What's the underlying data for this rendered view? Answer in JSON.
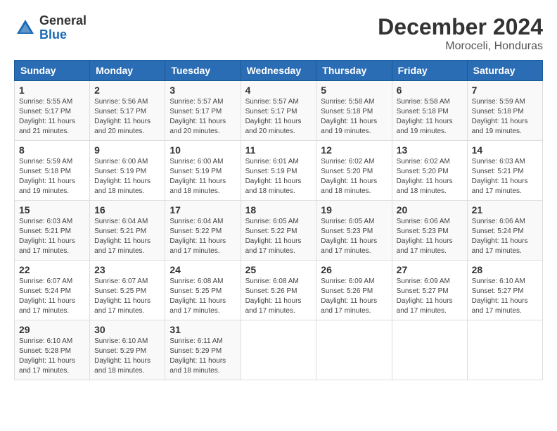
{
  "header": {
    "logo": {
      "line1": "General",
      "line2": "Blue"
    },
    "title": "December 2024",
    "subtitle": "Moroceli, Honduras"
  },
  "weekdays": [
    "Sunday",
    "Monday",
    "Tuesday",
    "Wednesday",
    "Thursday",
    "Friday",
    "Saturday"
  ],
  "weeks": [
    [
      {
        "day": 1,
        "sunrise": "5:55 AM",
        "sunset": "5:17 PM",
        "daylight": "11 hours and 21 minutes."
      },
      {
        "day": 2,
        "sunrise": "5:56 AM",
        "sunset": "5:17 PM",
        "daylight": "11 hours and 20 minutes."
      },
      {
        "day": 3,
        "sunrise": "5:57 AM",
        "sunset": "5:17 PM",
        "daylight": "11 hours and 20 minutes."
      },
      {
        "day": 4,
        "sunrise": "5:57 AM",
        "sunset": "5:17 PM",
        "daylight": "11 hours and 20 minutes."
      },
      {
        "day": 5,
        "sunrise": "5:58 AM",
        "sunset": "5:18 PM",
        "daylight": "11 hours and 19 minutes."
      },
      {
        "day": 6,
        "sunrise": "5:58 AM",
        "sunset": "5:18 PM",
        "daylight": "11 hours and 19 minutes."
      },
      {
        "day": 7,
        "sunrise": "5:59 AM",
        "sunset": "5:18 PM",
        "daylight": "11 hours and 19 minutes."
      }
    ],
    [
      {
        "day": 8,
        "sunrise": "5:59 AM",
        "sunset": "5:18 PM",
        "daylight": "11 hours and 19 minutes."
      },
      {
        "day": 9,
        "sunrise": "6:00 AM",
        "sunset": "5:19 PM",
        "daylight": "11 hours and 18 minutes."
      },
      {
        "day": 10,
        "sunrise": "6:00 AM",
        "sunset": "5:19 PM",
        "daylight": "11 hours and 18 minutes."
      },
      {
        "day": 11,
        "sunrise": "6:01 AM",
        "sunset": "5:19 PM",
        "daylight": "11 hours and 18 minutes."
      },
      {
        "day": 12,
        "sunrise": "6:02 AM",
        "sunset": "5:20 PM",
        "daylight": "11 hours and 18 minutes."
      },
      {
        "day": 13,
        "sunrise": "6:02 AM",
        "sunset": "5:20 PM",
        "daylight": "11 hours and 18 minutes."
      },
      {
        "day": 14,
        "sunrise": "6:03 AM",
        "sunset": "5:21 PM",
        "daylight": "11 hours and 17 minutes."
      }
    ],
    [
      {
        "day": 15,
        "sunrise": "6:03 AM",
        "sunset": "5:21 PM",
        "daylight": "11 hours and 17 minutes."
      },
      {
        "day": 16,
        "sunrise": "6:04 AM",
        "sunset": "5:21 PM",
        "daylight": "11 hours and 17 minutes."
      },
      {
        "day": 17,
        "sunrise": "6:04 AM",
        "sunset": "5:22 PM",
        "daylight": "11 hours and 17 minutes."
      },
      {
        "day": 18,
        "sunrise": "6:05 AM",
        "sunset": "5:22 PM",
        "daylight": "11 hours and 17 minutes."
      },
      {
        "day": 19,
        "sunrise": "6:05 AM",
        "sunset": "5:23 PM",
        "daylight": "11 hours and 17 minutes."
      },
      {
        "day": 20,
        "sunrise": "6:06 AM",
        "sunset": "5:23 PM",
        "daylight": "11 hours and 17 minutes."
      },
      {
        "day": 21,
        "sunrise": "6:06 AM",
        "sunset": "5:24 PM",
        "daylight": "11 hours and 17 minutes."
      }
    ],
    [
      {
        "day": 22,
        "sunrise": "6:07 AM",
        "sunset": "5:24 PM",
        "daylight": "11 hours and 17 minutes."
      },
      {
        "day": 23,
        "sunrise": "6:07 AM",
        "sunset": "5:25 PM",
        "daylight": "11 hours and 17 minutes."
      },
      {
        "day": 24,
        "sunrise": "6:08 AM",
        "sunset": "5:25 PM",
        "daylight": "11 hours and 17 minutes."
      },
      {
        "day": 25,
        "sunrise": "6:08 AM",
        "sunset": "5:26 PM",
        "daylight": "11 hours and 17 minutes."
      },
      {
        "day": 26,
        "sunrise": "6:09 AM",
        "sunset": "5:26 PM",
        "daylight": "11 hours and 17 minutes."
      },
      {
        "day": 27,
        "sunrise": "6:09 AM",
        "sunset": "5:27 PM",
        "daylight": "11 hours and 17 minutes."
      },
      {
        "day": 28,
        "sunrise": "6:10 AM",
        "sunset": "5:27 PM",
        "daylight": "11 hours and 17 minutes."
      }
    ],
    [
      {
        "day": 29,
        "sunrise": "6:10 AM",
        "sunset": "5:28 PM",
        "daylight": "11 hours and 17 minutes."
      },
      {
        "day": 30,
        "sunrise": "6:10 AM",
        "sunset": "5:29 PM",
        "daylight": "11 hours and 18 minutes."
      },
      {
        "day": 31,
        "sunrise": "6:11 AM",
        "sunset": "5:29 PM",
        "daylight": "11 hours and 18 minutes."
      },
      null,
      null,
      null,
      null
    ]
  ]
}
